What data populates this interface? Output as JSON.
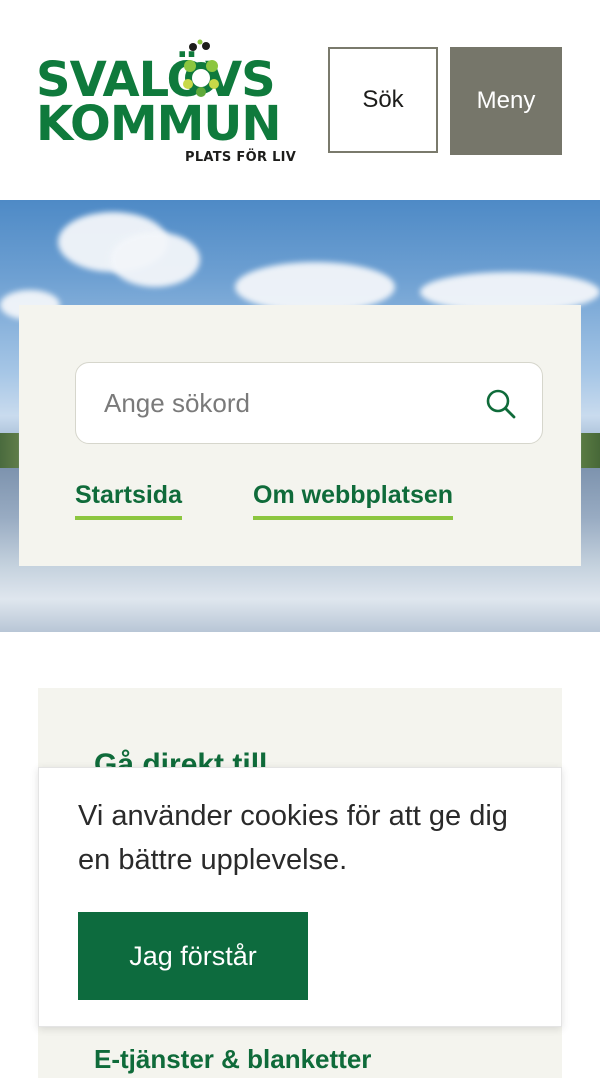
{
  "header": {
    "logo": {
      "line1": "SVALÖVS",
      "line2": "KOMMUN",
      "tagline": "PLATS FÖR LIV",
      "colors": {
        "green": "#0f7a3c",
        "lime": "#8cc63f",
        "dark": "#1d1d1b"
      }
    },
    "search_button_label": "Sök",
    "menu_button_label": "Meny"
  },
  "hero": {
    "search": {
      "placeholder": "Ange sökord",
      "value": ""
    },
    "quick_links": [
      {
        "label": "Startsida"
      },
      {
        "label": "Om webbplatsen"
      }
    ]
  },
  "shortcuts": {
    "title": "Gå direkt till",
    "items": [
      {
        "label": "E-tjänster & blanketter"
      }
    ]
  },
  "cookie_banner": {
    "message": "Vi använder cookies för att ge dig en bättre upplevelse.",
    "accept_label": "Jag förstår"
  },
  "colors": {
    "brand_green": "#0f6b3a",
    "accent_lime": "#8cc63f",
    "menu_gray": "#76766a",
    "panel_beige": "#f4f4ee"
  },
  "icons": {
    "search": "search-icon",
    "logo_emblem": "flower-emblem-icon"
  }
}
